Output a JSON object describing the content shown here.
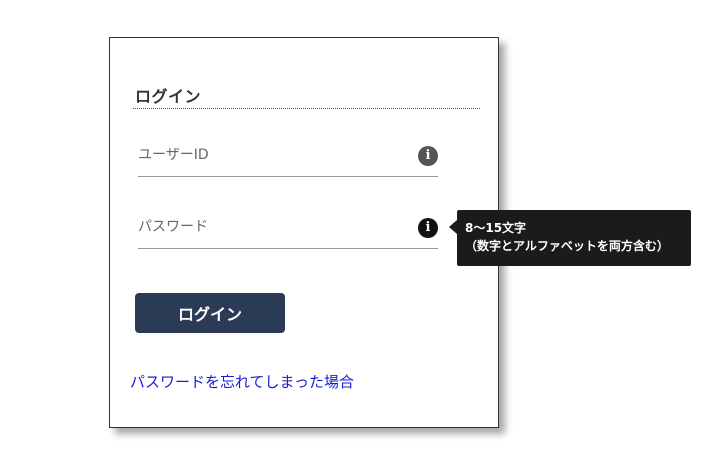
{
  "login_form": {
    "title": "ログイン",
    "username": {
      "placeholder": "ユーザーID",
      "info_icon": "info-icon"
    },
    "password": {
      "placeholder": "パスワード",
      "info_icon": "info-icon"
    },
    "submit_label": "ログイン",
    "forgot_link": "パスワードを忘れてしまった場合",
    "colors": {
      "button_bg": "#2b3a55",
      "link": "#1a1ad6",
      "tooltip_bg": "#1b1b1b"
    }
  },
  "tooltip": {
    "line1": "8～15文字",
    "line2": "（数字とアルファベットを両方含む）"
  }
}
